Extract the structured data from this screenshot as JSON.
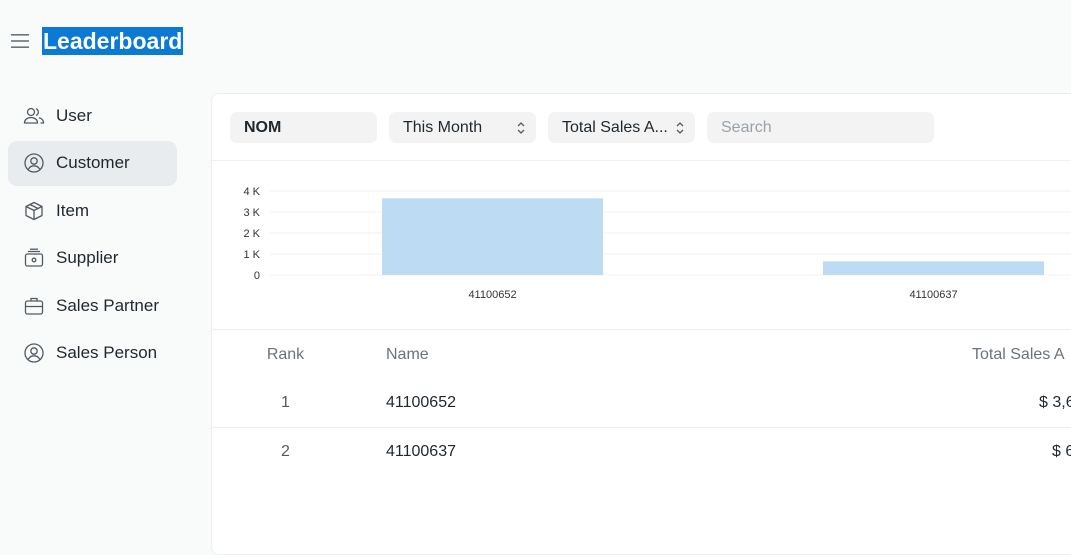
{
  "header": {
    "title": "Leaderboard",
    "menu_icon": "hamburger-icon"
  },
  "sidebar": {
    "items": [
      {
        "label": "User",
        "icon": "users-icon",
        "active": false
      },
      {
        "label": "Customer",
        "icon": "user-circle-icon",
        "active": true
      },
      {
        "label": "Item",
        "icon": "box-icon",
        "active": false
      },
      {
        "label": "Supplier",
        "icon": "supplier-icon",
        "active": false
      },
      {
        "label": "Sales Partner",
        "icon": "briefcase-icon",
        "active": false
      },
      {
        "label": "Sales Person",
        "icon": "user-circle-icon",
        "active": false
      }
    ]
  },
  "filters": {
    "company": "NOM",
    "period": "This Month",
    "field": "Total Sales A...",
    "search_placeholder": "Search"
  },
  "chart_data": {
    "type": "bar",
    "categories": [
      "41100652",
      "41100637"
    ],
    "values": [
      3650,
      650
    ],
    "ylim": [
      0,
      4000
    ],
    "yticks": [
      "0",
      "1 K",
      "2 K",
      "3 K",
      "4 K"
    ],
    "grid": true,
    "color": "#bddcf4"
  },
  "table": {
    "headers": {
      "rank": "Rank",
      "name": "Name",
      "sales": "Total Sales A"
    },
    "rows": [
      {
        "rank": "1",
        "name": "41100652",
        "sales": "$ 3,6"
      },
      {
        "rank": "2",
        "name": "41100637",
        "sales": "$ 6"
      }
    ]
  }
}
